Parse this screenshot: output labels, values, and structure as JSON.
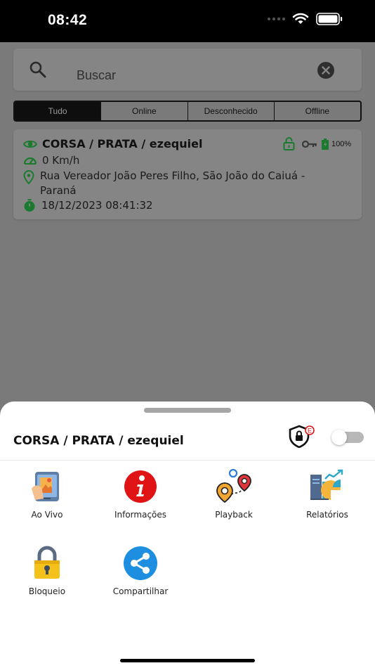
{
  "status_bar": {
    "time": "08:42"
  },
  "search": {
    "placeholder": "Buscar"
  },
  "filters": [
    {
      "label": "Tudo",
      "active": true
    },
    {
      "label": "Online",
      "active": false
    },
    {
      "label": "Desconhecido",
      "active": false
    },
    {
      "label": "Offline",
      "active": false
    }
  ],
  "vehicle": {
    "name": "CORSA / PRATA / ezequiel",
    "speed": "0 Km/h",
    "address_line1": "Rua Vereador João Peres Filho, São João do Caiuá -",
    "address_line2": "Paraná",
    "datetime": "18/12/2023 08:41:32",
    "battery": "100%"
  },
  "sheet": {
    "title": "CORSA / PRATA / ezequiel",
    "shield_badge": "E",
    "actions": [
      {
        "label": "Ao Vivo",
        "icon": "live-view-icon"
      },
      {
        "label": "Informações",
        "icon": "info-icon"
      },
      {
        "label": "Playback",
        "icon": "playback-route-icon"
      },
      {
        "label": "Relatórios",
        "icon": "reports-chart-icon"
      },
      {
        "label": "Bloqueio",
        "icon": "lock-icon"
      },
      {
        "label": "Compartilhar",
        "icon": "share-icon"
      }
    ]
  },
  "colors": {
    "accent_green": "#1a7a2e",
    "overlay_gray": "#7a7a7a",
    "info_red": "#e01414",
    "share_blue": "#1e8fe0",
    "lock_yellow": "#f4c21a"
  }
}
